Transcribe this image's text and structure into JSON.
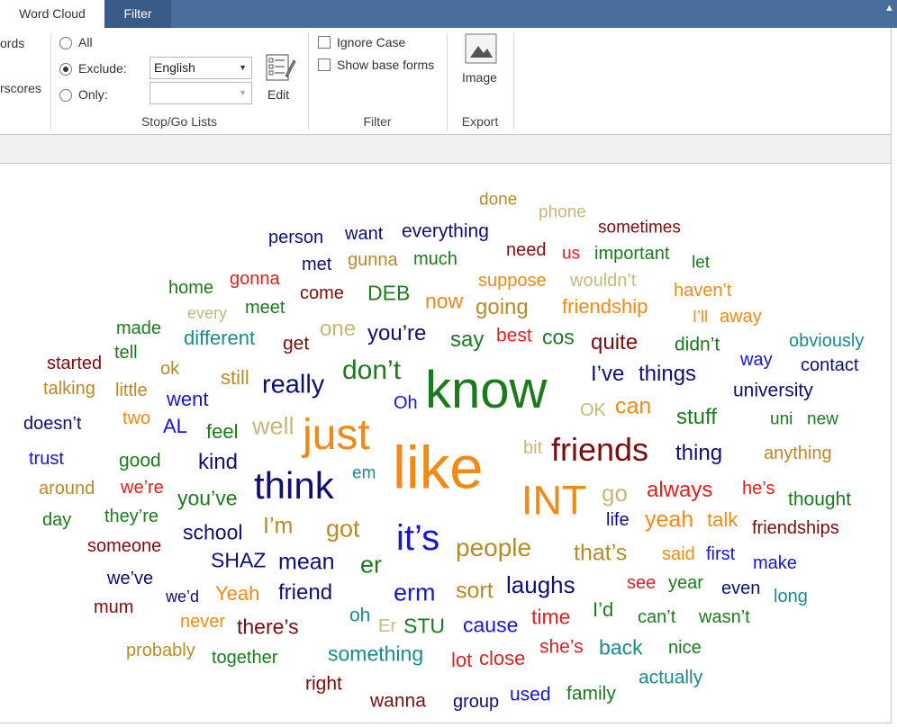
{
  "tabs": {
    "word_cloud": "Word Cloud",
    "filter": "Filter"
  },
  "ribbon": {
    "left_partial": {
      "line1": "ords",
      "line2": "rscores"
    },
    "stopgo": {
      "all_label": "All",
      "exclude_label": "Exclude:",
      "only_label": "Only:",
      "exclude_list_value": "English",
      "only_list_value": "",
      "edit_label": "Edit",
      "group_label": "Stop/Go Lists"
    },
    "filter": {
      "ignore_case_label": "Ignore Case",
      "show_base_forms_label": "Show base forms",
      "group_label": "Filter"
    },
    "export": {
      "image_label": "Image",
      "group_label": "Export"
    }
  },
  "colors": {
    "navy": "#0e0e78",
    "green": "#1c7a1c",
    "darkred": "#7d0c0c",
    "orange": "#f08a14",
    "gold": "#b88a28",
    "khaki": "#c8b878",
    "teal": "#1a8a8a",
    "blue": "#1414dc",
    "red": "#e21e1e",
    "tab_bar": "#4a6e9b"
  },
  "words": [
    {
      "text": "done",
      "color": "gold"
    },
    {
      "text": "phone",
      "color": "khaki"
    },
    {
      "text": "sometimes",
      "color": "darkred"
    },
    {
      "text": "person",
      "color": "navy"
    },
    {
      "text": "want",
      "color": "navy"
    },
    {
      "text": "everything",
      "color": "navy"
    },
    {
      "text": "need",
      "color": "darkred"
    },
    {
      "text": "us",
      "color": "red"
    },
    {
      "text": "important",
      "color": "green"
    },
    {
      "text": "met",
      "color": "navy"
    },
    {
      "text": "gunna",
      "color": "gold"
    },
    {
      "text": "much",
      "color": "green"
    },
    {
      "text": "let",
      "color": "green"
    },
    {
      "text": "home",
      "color": "green"
    },
    {
      "text": "gonna",
      "color": "red"
    },
    {
      "text": "suppose",
      "color": "orange"
    },
    {
      "text": "wouldn’t",
      "color": "khaki"
    },
    {
      "text": "come",
      "color": "darkred"
    },
    {
      "text": "DEB",
      "color": "green"
    },
    {
      "text": "haven’t",
      "color": "orange"
    },
    {
      "text": "meet",
      "color": "green"
    },
    {
      "text": "every",
      "color": "khaki"
    },
    {
      "text": "now",
      "color": "orange"
    },
    {
      "text": "going",
      "color": "gold"
    },
    {
      "text": "friendship",
      "color": "orange"
    },
    {
      "text": "I’ll",
      "color": "orange"
    },
    {
      "text": "away",
      "color": "orange"
    },
    {
      "text": "made",
      "color": "green"
    },
    {
      "text": "one",
      "color": "khaki"
    },
    {
      "text": "you’re",
      "color": "navy"
    },
    {
      "text": "different",
      "color": "teal"
    },
    {
      "text": "get",
      "color": "darkred"
    },
    {
      "text": "say",
      "color": "green"
    },
    {
      "text": "best",
      "color": "red"
    },
    {
      "text": "cos",
      "color": "green"
    },
    {
      "text": "quite",
      "color": "darkred"
    },
    {
      "text": "didn’t",
      "color": "green"
    },
    {
      "text": "obviously",
      "color": "teal"
    },
    {
      "text": "tell",
      "color": "green"
    },
    {
      "text": "started",
      "color": "darkred"
    },
    {
      "text": "way",
      "color": "blue"
    },
    {
      "text": "contact",
      "color": "navy"
    },
    {
      "text": "ok",
      "color": "gold"
    },
    {
      "text": "don’t",
      "color": "green"
    },
    {
      "text": "still",
      "color": "gold"
    },
    {
      "text": "know",
      "color": "green"
    },
    {
      "text": "I’ve",
      "color": "navy"
    },
    {
      "text": "things",
      "color": "navy"
    },
    {
      "text": "talking",
      "color": "gold"
    },
    {
      "text": "little",
      "color": "gold"
    },
    {
      "text": "really",
      "color": "navy"
    },
    {
      "text": "university",
      "color": "navy"
    },
    {
      "text": "went",
      "color": "blue"
    },
    {
      "text": "Oh",
      "color": "blue"
    },
    {
      "text": "OK",
      "color": "khaki"
    },
    {
      "text": "can",
      "color": "orange"
    },
    {
      "text": "doesn’t",
      "color": "navy"
    },
    {
      "text": "two",
      "color": "orange"
    },
    {
      "text": "AL",
      "color": "blue"
    },
    {
      "text": "well",
      "color": "khaki"
    },
    {
      "text": "stuff",
      "color": "green"
    },
    {
      "text": "uni",
      "color": "green"
    },
    {
      "text": "new",
      "color": "green"
    },
    {
      "text": "feel",
      "color": "green"
    },
    {
      "text": "just",
      "color": "orange"
    },
    {
      "text": "trust",
      "color": "blue"
    },
    {
      "text": "bit",
      "color": "khaki"
    },
    {
      "text": "friends",
      "color": "darkred"
    },
    {
      "text": "thing",
      "color": "navy"
    },
    {
      "text": "anything",
      "color": "gold"
    },
    {
      "text": "good",
      "color": "green"
    },
    {
      "text": "kind",
      "color": "navy"
    },
    {
      "text": "like",
      "color": "orange"
    },
    {
      "text": "em",
      "color": "teal"
    },
    {
      "text": "think",
      "color": "navy"
    },
    {
      "text": "around",
      "color": "gold"
    },
    {
      "text": "we’re",
      "color": "red"
    },
    {
      "text": "always",
      "color": "red"
    },
    {
      "text": "he’s",
      "color": "red"
    },
    {
      "text": "INT",
      "color": "orange"
    },
    {
      "text": "go",
      "color": "khaki"
    },
    {
      "text": "thought",
      "color": "green"
    },
    {
      "text": "you’ve",
      "color": "green"
    },
    {
      "text": "day",
      "color": "green"
    },
    {
      "text": "they’re",
      "color": "green"
    },
    {
      "text": "life",
      "color": "navy"
    },
    {
      "text": "yeah",
      "color": "orange"
    },
    {
      "text": "talk",
      "color": "orange"
    },
    {
      "text": "I’m",
      "color": "gold"
    },
    {
      "text": "got",
      "color": "gold"
    },
    {
      "text": "school",
      "color": "navy"
    },
    {
      "text": "it’s",
      "color": "blue"
    },
    {
      "text": "friendships",
      "color": "darkred"
    },
    {
      "text": "someone",
      "color": "darkred"
    },
    {
      "text": "people",
      "color": "gold"
    },
    {
      "text": "that’s",
      "color": "gold"
    },
    {
      "text": "said",
      "color": "orange"
    },
    {
      "text": "first",
      "color": "blue"
    },
    {
      "text": "SHAZ",
      "color": "navy"
    },
    {
      "text": "mean",
      "color": "navy"
    },
    {
      "text": "er",
      "color": "green"
    },
    {
      "text": "make",
      "color": "blue"
    },
    {
      "text": "we’ve",
      "color": "navy"
    },
    {
      "text": "laughs",
      "color": "navy"
    },
    {
      "text": "see",
      "color": "red"
    },
    {
      "text": "year",
      "color": "green"
    },
    {
      "text": "even",
      "color": "navy"
    },
    {
      "text": "sort",
      "color": "gold"
    },
    {
      "text": "long",
      "color": "teal"
    },
    {
      "text": "we’d",
      "color": "navy"
    },
    {
      "text": "Yeah",
      "color": "orange"
    },
    {
      "text": "friend",
      "color": "navy"
    },
    {
      "text": "erm",
      "color": "blue"
    },
    {
      "text": "mum",
      "color": "darkred"
    },
    {
      "text": "I’d",
      "color": "green"
    },
    {
      "text": "can’t",
      "color": "green"
    },
    {
      "text": "wasn’t",
      "color": "green"
    },
    {
      "text": "oh",
      "color": "teal"
    },
    {
      "text": "time",
      "color": "red"
    },
    {
      "text": "never",
      "color": "orange"
    },
    {
      "text": "there’s",
      "color": "darkred"
    },
    {
      "text": "Er",
      "color": "khaki"
    },
    {
      "text": "STU",
      "color": "green"
    },
    {
      "text": "cause",
      "color": "blue"
    },
    {
      "text": "probably",
      "color": "gold"
    },
    {
      "text": "she’s",
      "color": "red"
    },
    {
      "text": "back",
      "color": "teal"
    },
    {
      "text": "nice",
      "color": "green"
    },
    {
      "text": "together",
      "color": "green"
    },
    {
      "text": "something",
      "color": "teal"
    },
    {
      "text": "lot",
      "color": "red"
    },
    {
      "text": "close",
      "color": "red"
    },
    {
      "text": "actually",
      "color": "teal"
    },
    {
      "text": "right",
      "color": "darkred"
    },
    {
      "text": "used",
      "color": "blue"
    },
    {
      "text": "family",
      "color": "green"
    },
    {
      "text": "wanna",
      "color": "darkred"
    },
    {
      "text": "group",
      "color": "navy"
    }
  ]
}
